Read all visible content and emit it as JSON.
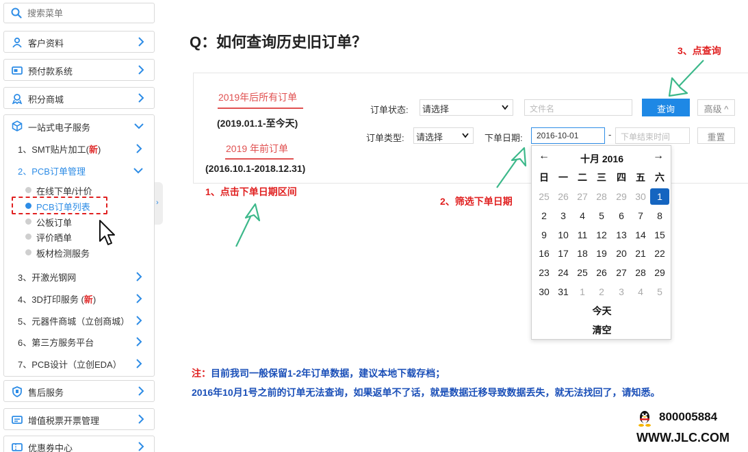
{
  "sidebar": {
    "search_placeholder": "搜索菜单",
    "top_items": [
      {
        "label": "客户资料",
        "icon": "user-icon"
      },
      {
        "label": "预付款系统",
        "icon": "card-icon"
      },
      {
        "label": "积分商城",
        "icon": "gift-icon"
      }
    ],
    "group": {
      "label": "一站式电子服务",
      "icon": "cube-icon",
      "items": [
        {
          "label": "1、SMT贴片加工(",
          "badge": "新",
          "suffix": ")"
        },
        {
          "label": "2、PCB订单管理"
        },
        {
          "label": "3、开激光钢网"
        },
        {
          "label": "4、3D打印服务 (",
          "badge": "新",
          "suffix": ")"
        },
        {
          "label": "5、元器件商城（立创商城）"
        },
        {
          "label": "6、第三方服务平台"
        },
        {
          "label": "7、PCB设计（立创EDA）"
        }
      ],
      "pcb_children": [
        "在线下单/计价",
        "PCB订单列表",
        "公板订单",
        "评价晒单",
        "板材检测服务"
      ]
    },
    "bottom_items": [
      {
        "label": "售后服务",
        "icon": "shield-icon"
      },
      {
        "label": "增值税票开票管理",
        "icon": "invoice-icon"
      },
      {
        "label": "优惠券中心",
        "icon": "coupon-icon"
      }
    ]
  },
  "main": {
    "title": "Q：如何查询历史旧订单？",
    "tabs": {
      "after_label": "2019年后所有订单",
      "after_range": "(2019.01.1-至今天)",
      "before_label": "2019 年前订单",
      "before_range": "(2016.10.1-2018.12.31)"
    },
    "form": {
      "status_label": "订单状态:",
      "status_value": "请选择",
      "filename_placeholder": "文件名",
      "query_button": "查询",
      "advanced_button": "高级 ^",
      "type_label": "订单类型:",
      "type_value": "请选择",
      "date_label": "下单日期:",
      "date_start": "2016-10-01",
      "date_sep": "-",
      "date_end_placeholder": "下单结束时间",
      "reset_button": "重置"
    },
    "calendar": {
      "prev": "←",
      "next": "→",
      "title": "十月 2016",
      "weekdays": [
        "日",
        "一",
        "二",
        "三",
        "四",
        "五",
        "六"
      ],
      "weeks": [
        [
          "25",
          "26",
          "27",
          "28",
          "29",
          "30",
          "1"
        ],
        [
          "2",
          "3",
          "4",
          "5",
          "6",
          "7",
          "8"
        ],
        [
          "9",
          "10",
          "11",
          "12",
          "13",
          "14",
          "15"
        ],
        [
          "16",
          "17",
          "18",
          "19",
          "20",
          "21",
          "22"
        ],
        [
          "23",
          "24",
          "25",
          "26",
          "27",
          "28",
          "29"
        ],
        [
          "30",
          "31",
          "1",
          "2",
          "3",
          "4",
          "5"
        ]
      ],
      "today": "今天",
      "clear": "清空"
    },
    "annotations": {
      "step1": "1、点击下单日期区间",
      "step2": "2、筛选下单日期",
      "step3": "3、点查询"
    },
    "notes": {
      "prefix": "注：",
      "line1": "目前我司一般保留1-2年订单数据，建议本地下载存档；",
      "line2": "2016年10月1号之前的订单无法查询，如果返单不了话，就是数据迁移导致数据丢失，就无法找回了，请知悉。"
    },
    "contact": {
      "qq": "800005884",
      "site": "WWW.JLC.COM"
    }
  }
}
